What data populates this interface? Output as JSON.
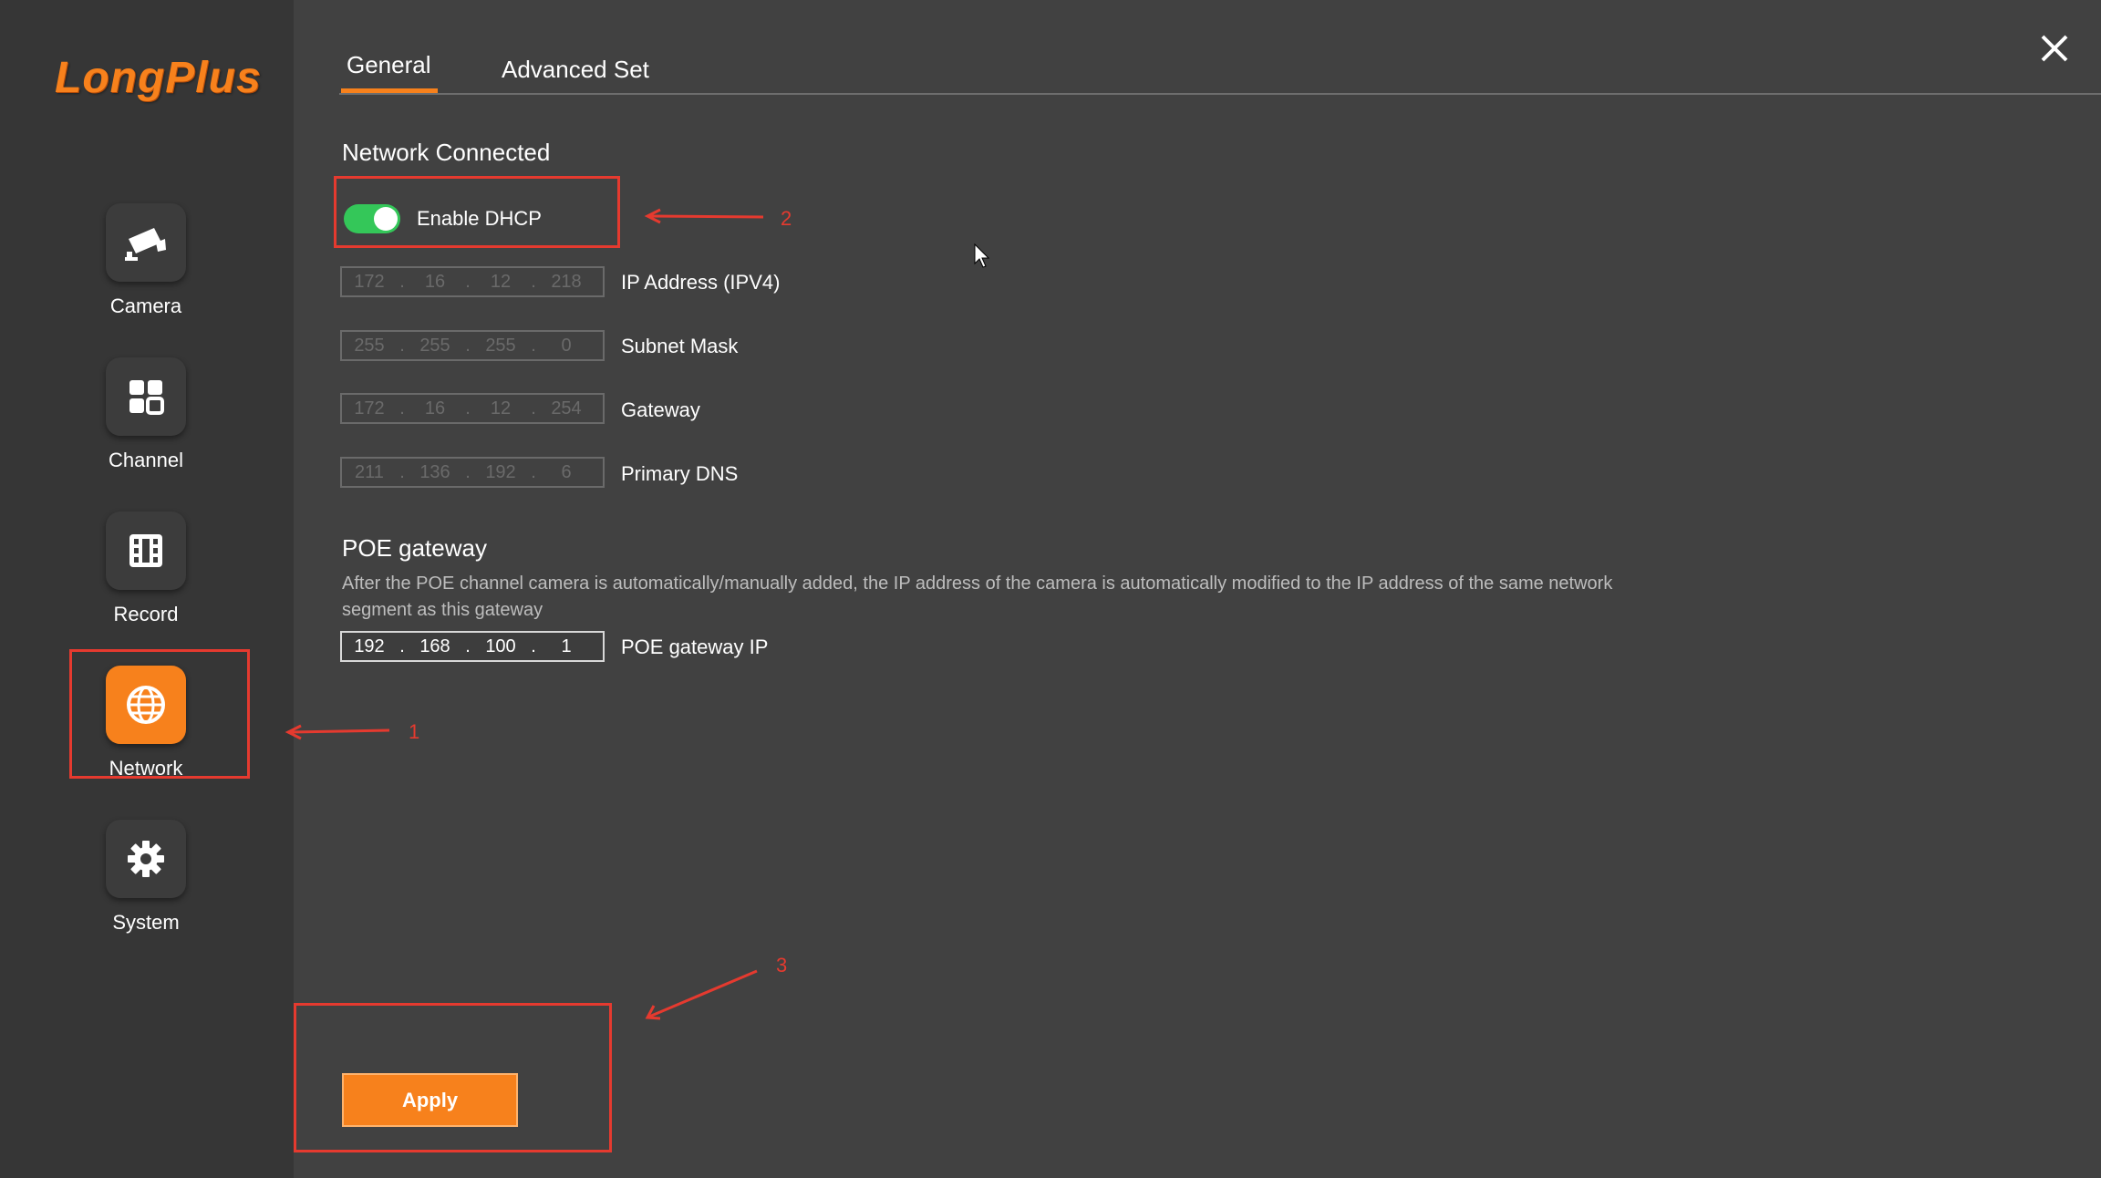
{
  "brand": {
    "logo_text": "LongPlus",
    "accent_color": "#f7811c"
  },
  "sidebar": {
    "items": [
      {
        "label": "Camera",
        "icon": "camera-icon",
        "active": false
      },
      {
        "label": "Channel",
        "icon": "grid-icon",
        "active": false
      },
      {
        "label": "Record",
        "icon": "film-icon",
        "active": false
      },
      {
        "label": "Network",
        "icon": "globe-icon",
        "active": true
      },
      {
        "label": "System",
        "icon": "gear-icon",
        "active": false
      }
    ]
  },
  "tabs": [
    {
      "label": "General",
      "active": true
    },
    {
      "label": "Advanced Set",
      "active": false
    }
  ],
  "close_icon": "close-icon",
  "network": {
    "status": "Network Connected",
    "dhcp": {
      "label": "Enable DHCP",
      "enabled": true
    },
    "fields": [
      {
        "label": "IP Address (IPV4)",
        "octets": [
          "172",
          "16",
          "12",
          "218"
        ]
      },
      {
        "label": "Subnet Mask",
        "octets": [
          "255",
          "255",
          "255",
          "0"
        ]
      },
      {
        "label": "Gateway",
        "octets": [
          "172",
          "16",
          "12",
          "254"
        ]
      },
      {
        "label": "Primary DNS",
        "octets": [
          "211",
          "136",
          "192",
          "6"
        ]
      }
    ]
  },
  "poe": {
    "title": "POE gateway",
    "description": "After the POE channel camera is automatically/manually added, the IP address of the camera is automatically modified to the IP address of the same network segment as this gateway",
    "field": {
      "label": "POE gateway IP",
      "octets": [
        "192",
        "168",
        "100",
        "1"
      ]
    }
  },
  "apply_label": "Apply",
  "annotations": [
    "1",
    "2",
    "3"
  ],
  "colors": {
    "annotation": "#e53a2f",
    "toggle_on": "#34c759",
    "background": "#414141",
    "sidebar": "#363636"
  }
}
